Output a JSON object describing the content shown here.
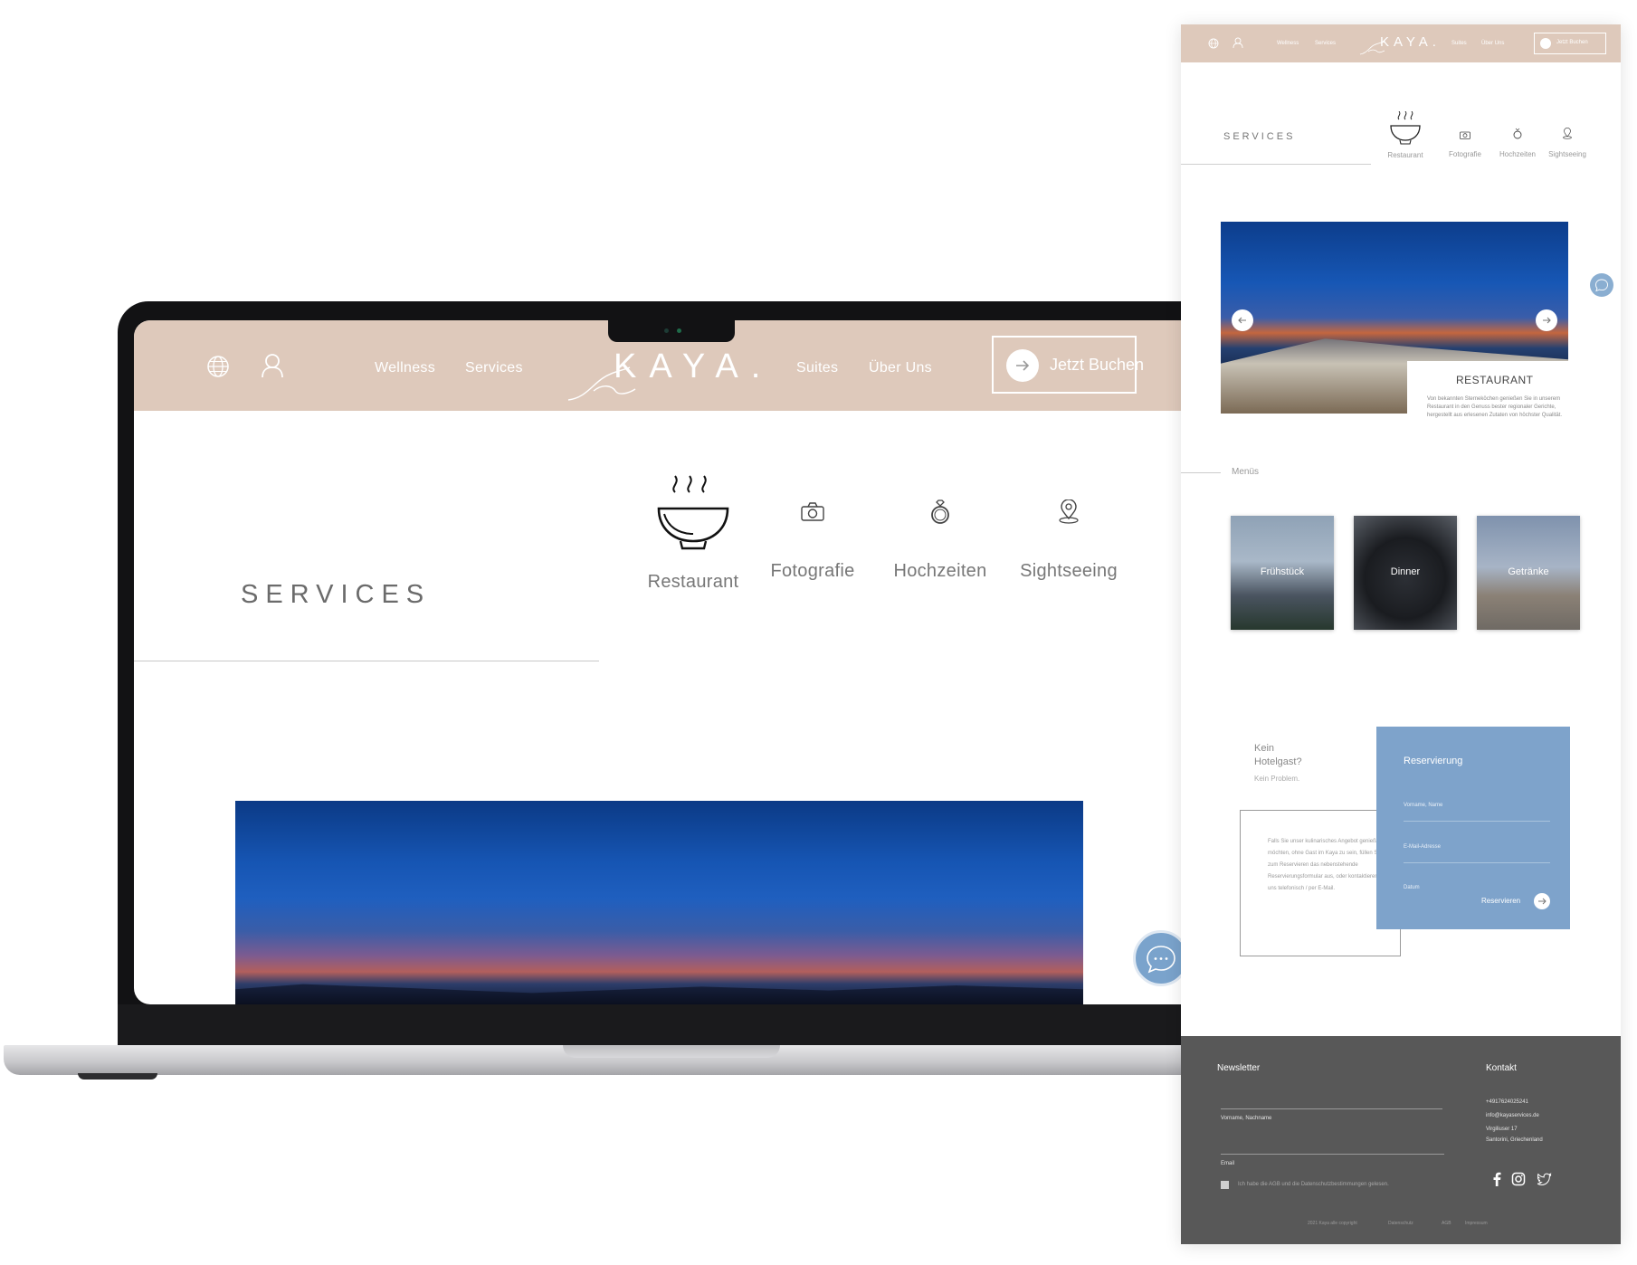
{
  "laptop": {
    "header": {
      "nav_left": [
        "Wellness",
        "Services"
      ],
      "nav_right": [
        "Suites",
        "Über Uns"
      ],
      "logo": "KAYA.",
      "book_label": "Jetzt Buchen"
    },
    "services_title": "SERVICES",
    "services": [
      {
        "label": "Restaurant",
        "icon": "bowl-icon"
      },
      {
        "label": "Fotografie",
        "icon": "camera-icon"
      },
      {
        "label": "Hochzeiten",
        "icon": "ring-icon"
      },
      {
        "label": "Sightseeing",
        "icon": "map-pin-icon"
      }
    ]
  },
  "mobile": {
    "header": {
      "nav_left": [
        "Wellness",
        "Services"
      ],
      "nav_right": [
        "Suites",
        "Über Uns"
      ],
      "logo": "KAYA.",
      "book_label": "Jetzt Buchen"
    },
    "services_title": "SERVICES",
    "services": [
      "Restaurant",
      "Fotografie",
      "Hochzeiten",
      "Sightseeing"
    ],
    "restaurant": {
      "title": "RESTAURANT",
      "description": "Von bekannten Sterneköchen genießen Sie in unserem Restaurant in den Genuss bester regionaler Gerichte, hergestellt aus erlesenen Zutaten von höchster Qualität."
    },
    "menus_title": "Menüs",
    "menus": [
      "Frühstück",
      "Dinner",
      "Getränke"
    ],
    "guest": {
      "title_line1": "Kein",
      "title_line2": "Hotelgast?",
      "subtitle": "Kein Problem.",
      "text": "Falls Sie unser kulinarisches Angebot genießen möchten, ohne Gast im Kaya zu sein, füllen Sie zum Reservieren das nebenstehende Reservierungsformular aus, oder kontaktieren Sie uns telefonisch / per E-Mail."
    },
    "reservation": {
      "title": "Reservierung",
      "fields": [
        "Vorname, Name",
        "E-Mail-Adresse",
        "Datum"
      ],
      "button": "Reservieren"
    },
    "footer": {
      "newsletter_title": "Newsletter",
      "name_field": "Vorname, Nachname",
      "email_field": "Email",
      "consent": "Ich habe die AGB und die Datenschutzbestimmungen gelesen.",
      "contact_title": "Kontakt",
      "phone": "+4917624025241",
      "email": "info@kayaservices.de",
      "street": "Virgiliuser 17",
      "city": "Santorini, Griechenland",
      "legal": [
        "2021 Kaya alle copyright",
        "Datenschutz",
        "AGB",
        "Impressum"
      ]
    }
  },
  "colors": {
    "header": "#dec9bb",
    "accent_blue": "#7ea3cb",
    "footer": "#585858"
  }
}
